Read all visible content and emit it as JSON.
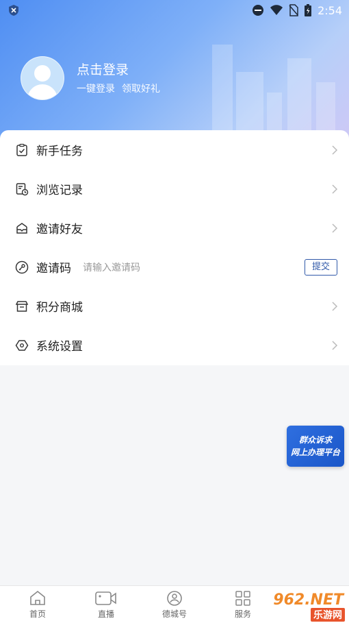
{
  "status_bar": {
    "time": "2:54"
  },
  "profile": {
    "title": "点击登录",
    "sub1": "一键登录",
    "sub2": "领取好礼"
  },
  "menu": {
    "items": [
      {
        "label": "新手任务"
      },
      {
        "label": "浏览记录"
      },
      {
        "label": "邀请好友"
      },
      {
        "label": "邀请码",
        "placeholder": "请输入邀请码",
        "button": "提交"
      },
      {
        "label": "积分商城"
      },
      {
        "label": "系统设置"
      }
    ]
  },
  "float_card": {
    "line1": "群众诉求",
    "line2": "网上办理平台"
  },
  "tabs": [
    {
      "label": "首页"
    },
    {
      "label": "直播"
    },
    {
      "label": "德城号"
    },
    {
      "label": "服务"
    }
  ],
  "watermark": {
    "top": "962.NET",
    "bottom": "乐游网"
  }
}
